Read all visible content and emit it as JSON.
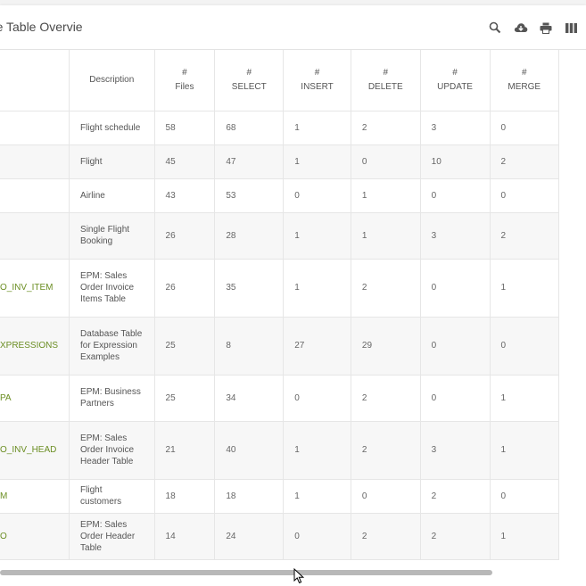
{
  "header": {
    "title": "base Table Overvie",
    "tools": [
      {
        "name": "search-icon"
      },
      {
        "name": "cloud-download-icon"
      },
      {
        "name": "print-icon"
      },
      {
        "name": "columns-icon"
      }
    ]
  },
  "table": {
    "columns": [
      {
        "hash": "",
        "label": ""
      },
      {
        "hash": "",
        "label": "Description"
      },
      {
        "hash": "#",
        "label": "Files"
      },
      {
        "hash": "#",
        "label": "SELECT"
      },
      {
        "hash": "#",
        "label": "INSERT"
      },
      {
        "hash": "#",
        "label": "DELETE"
      },
      {
        "hash": "#",
        "label": "UPDATE"
      },
      {
        "hash": "#",
        "label": "MERGE"
      }
    ],
    "rows": [
      {
        "name": "",
        "desc": "Flight schedule",
        "files": "58",
        "select": "68",
        "insert": "1",
        "delete": "2",
        "update": "3",
        "merge": "0"
      },
      {
        "name": "",
        "desc": "Flight",
        "files": "45",
        "select": "47",
        "insert": "1",
        "delete": "0",
        "update": "10",
        "merge": "2"
      },
      {
        "name": "",
        "desc": "Airline",
        "files": "43",
        "select": "53",
        "insert": "0",
        "delete": "1",
        "update": "0",
        "merge": "0"
      },
      {
        "name": "",
        "desc": "Single Flight Booking",
        "files": "26",
        "select": "28",
        "insert": "1",
        "delete": "1",
        "update": "3",
        "merge": "2"
      },
      {
        "name": "O_INV_ITEM",
        "desc": "EPM: Sales Order Invoice Items Table",
        "files": "26",
        "select": "35",
        "insert": "1",
        "delete": "2",
        "update": "0",
        "merge": "1"
      },
      {
        "name": "XPRESSIONS",
        "desc": "Database Table for Expression Examples",
        "files": "25",
        "select": "8",
        "insert": "27",
        "delete": "29",
        "update": "0",
        "merge": "0"
      },
      {
        "name": "PA",
        "desc": "EPM: Business Partners",
        "files": "25",
        "select": "34",
        "insert": "0",
        "delete": "2",
        "update": "0",
        "merge": "1"
      },
      {
        "name": "O_INV_HEAD",
        "desc": "EPM: Sales Order Invoice Header Table",
        "files": "21",
        "select": "40",
        "insert": "1",
        "delete": "2",
        "update": "3",
        "merge": "1"
      },
      {
        "name": "M",
        "desc": "Flight customers",
        "files": "18",
        "select": "18",
        "insert": "1",
        "delete": "0",
        "update": "2",
        "merge": "0"
      },
      {
        "name": "O",
        "desc": "EPM: Sales Order Header Table",
        "files": "14",
        "select": "24",
        "insert": "0",
        "delete": "2",
        "update": "2",
        "merge": "1"
      }
    ],
    "row_heights": [
      38,
      38,
      38,
      52,
      65,
      65,
      52,
      65,
      38,
      52
    ]
  },
  "colors": {
    "link": "#6b8e23",
    "alt_row": "#f7f7f7"
  }
}
